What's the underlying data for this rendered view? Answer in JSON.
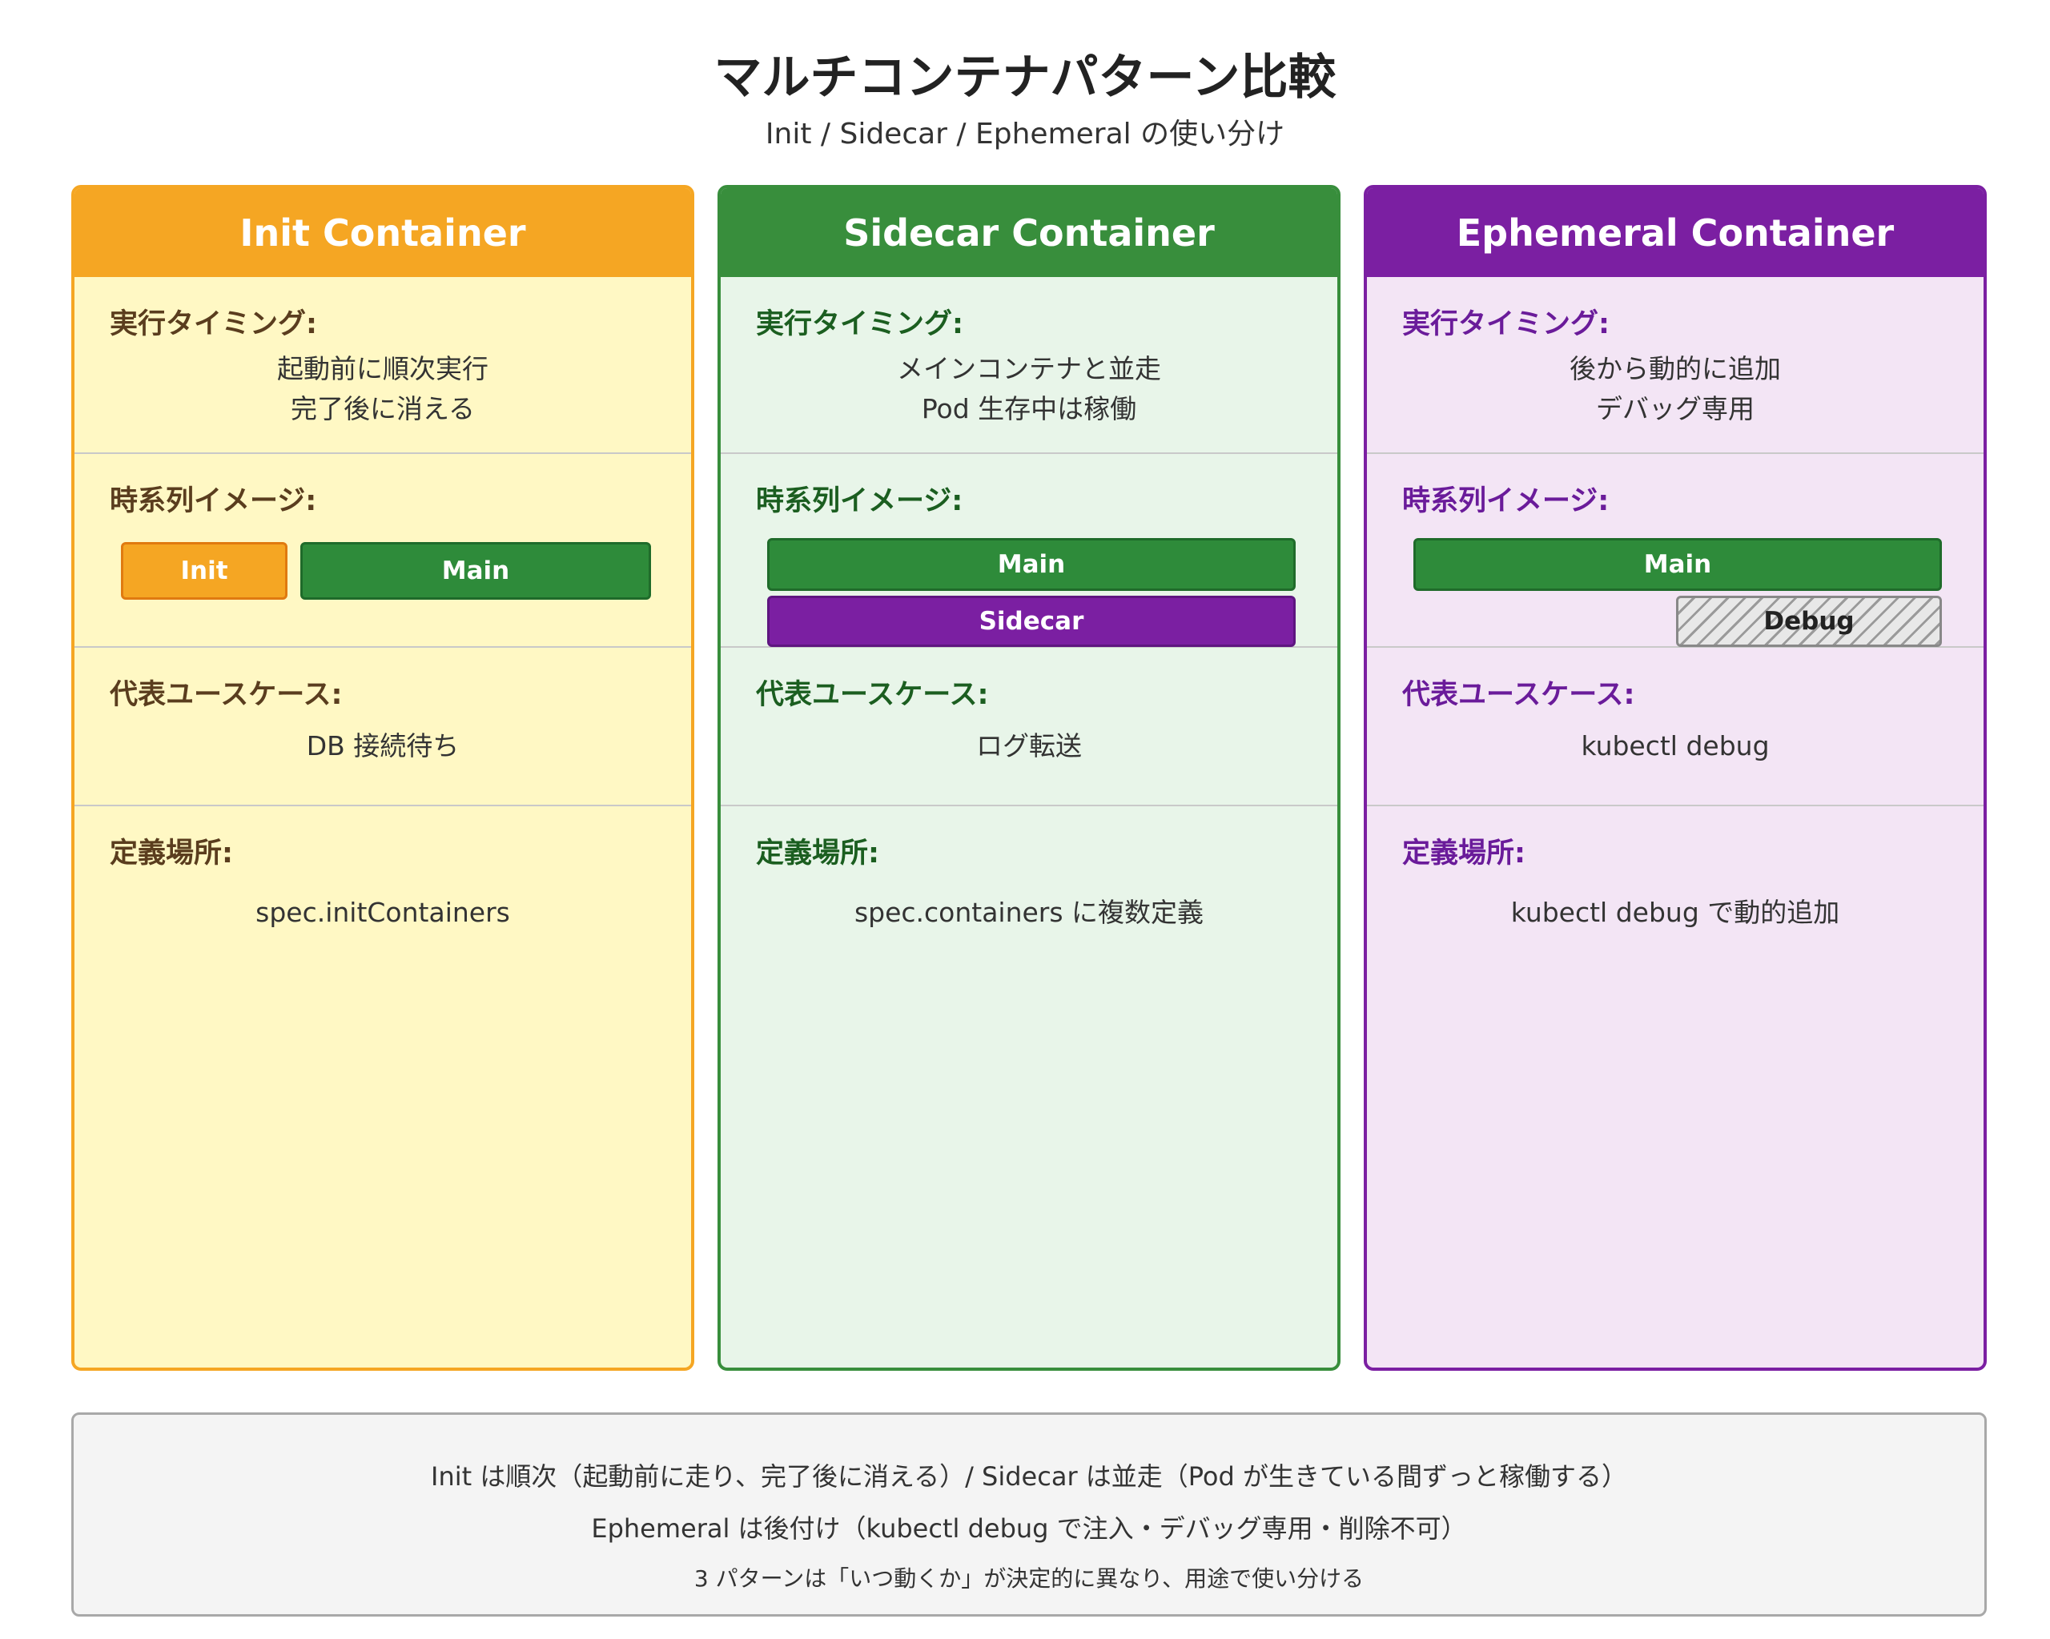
{
  "title": "マルチコンテナパターン比較",
  "subtitle": "Init / Sidecar / Ephemeral の使い分け",
  "labels": {
    "timing": "実行タイミング:",
    "timeline": "時系列イメージ:",
    "usecase": "代表ユースケース:",
    "definition": "定義場所:"
  },
  "cards": [
    {
      "title": "Init Container",
      "header_color": "#f5a623",
      "bg_color": "#fff8c4",
      "label_color": "#5a3d1e",
      "timing_lines": [
        "起動前に順次実行",
        "完了後に消える"
      ],
      "timeline": {
        "bar1": "Init",
        "bar2": "Main"
      },
      "usecase": "DB 接続待ち",
      "definition": "spec.initContainers"
    },
    {
      "title": "Sidecar Container",
      "header_color": "#388e3c",
      "bg_color": "#e8f5e9",
      "label_color": "#1b5e20",
      "timing_lines": [
        "メインコンテナと並走",
        "Pod 生存中は稼働"
      ],
      "timeline": {
        "bar1": "Main",
        "bar2": "Sidecar"
      },
      "usecase": "ログ転送",
      "definition": "spec.containers に複数定義"
    },
    {
      "title": "Ephemeral Container",
      "header_color": "#7b1fa2",
      "bg_color": "#f3e5f5",
      "label_color": "#6a1b9a",
      "timing_lines": [
        "後から動的に追加",
        "デバッグ専用"
      ],
      "timeline": {
        "bar1": "Main",
        "bar2": "Debug"
      },
      "usecase": "kubectl debug",
      "definition": "kubectl debug で動的追加"
    }
  ],
  "summary": [
    "Init は順次（起動前に走り、完了後に消える）/ Sidecar は並走（Pod が生きている間ずっと稼働する）",
    "Ephemeral は後付け（kubectl debug で注入・デバッグ専用・削除不可）",
    "3 パターンは「いつ動くか」が決定的に異なり、用途で使い分ける"
  ]
}
